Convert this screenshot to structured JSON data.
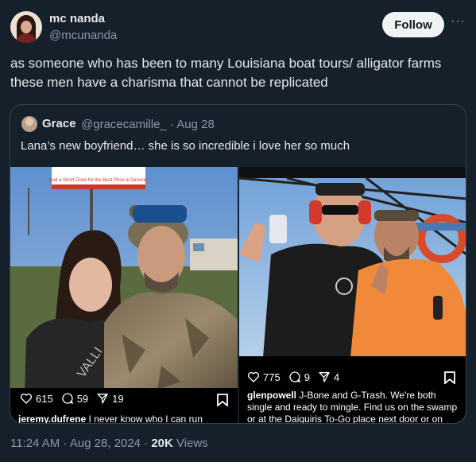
{
  "author": {
    "name": "mc nanda",
    "handle": "@mcunanda",
    "follow_label": "Follow",
    "more_label": "···"
  },
  "tweet": {
    "text": "as someone who has been to many Louisiana boat tours/ alligator farms these men have a charisma that cannot be replicated"
  },
  "quoted": {
    "name": "Grace",
    "handle": "@gracecamille_",
    "date": "· Aug 28",
    "text": "Lana’s new boyfriend… she is so incredible i love her so much",
    "left_post": {
      "sign_text": "and a Short Drive for the Best Price & Service!",
      "shirt_text": "VALLI",
      "likes": "615",
      "comments": "59",
      "shares": "19",
      "caption_user": "jeremy.dufrene",
      "caption": "I never know who I can run"
    },
    "right_post": {
      "likes": "775",
      "comments": "9",
      "shares": "4",
      "caption_user": "glenpowell",
      "caption": "J-Bone and G-Trash. We're both single and ready to mingle. Find us on the swamp or at the Daiquiris To-Go place next door or on Craigslist"
    }
  },
  "footer": {
    "time": "11:24 AM · Aug 28, 2024 · ",
    "views_count": "20K",
    "views_label": " Views"
  },
  "colors": {
    "background": "#15202b",
    "border": "#38444d",
    "muted": "#8b98a5",
    "text": "#e7e9ea"
  }
}
